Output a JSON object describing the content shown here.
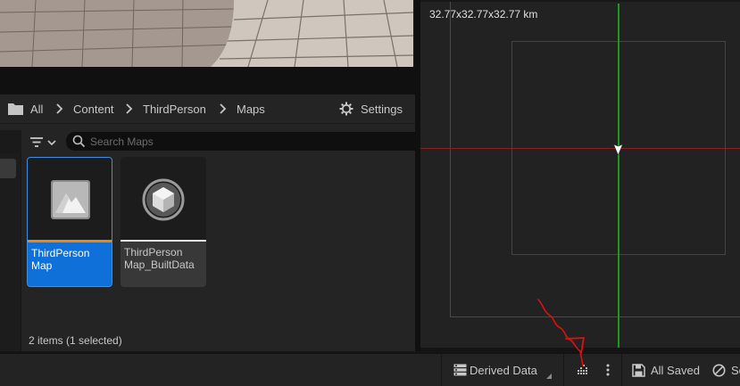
{
  "breadcrumb": {
    "items": [
      "All",
      "Content",
      "ThirdPerson",
      "Maps"
    ]
  },
  "toolbar": {
    "settings_label": "Settings"
  },
  "search": {
    "placeholder": "Search Maps",
    "value": ""
  },
  "assets": [
    {
      "label_line1": "ThirdPerson",
      "label_line2": "Map",
      "selected": true,
      "icon": "level-map-icon",
      "accent": "#e08c1c"
    },
    {
      "label_line1": "ThirdPerson",
      "label_line2": "Map_BuiltData",
      "selected": false,
      "icon": "built-data-icon",
      "accent": "#e8e8e8"
    }
  ],
  "status": {
    "items_count": "2 items (1 selected)"
  },
  "world_view": {
    "scale_text": "32.77x32.77x32.77 km",
    "colors": {
      "y_axis": "#1b9a1b",
      "x_axis": "#8a2020"
    }
  },
  "status_bar": {
    "derived_data_label": "Derived Data",
    "all_saved_label": "All Saved",
    "source_control_label": "Source Control"
  },
  "colors": {
    "selection": "#0e70d8",
    "background": "#242424",
    "annotation": "#e01010"
  }
}
